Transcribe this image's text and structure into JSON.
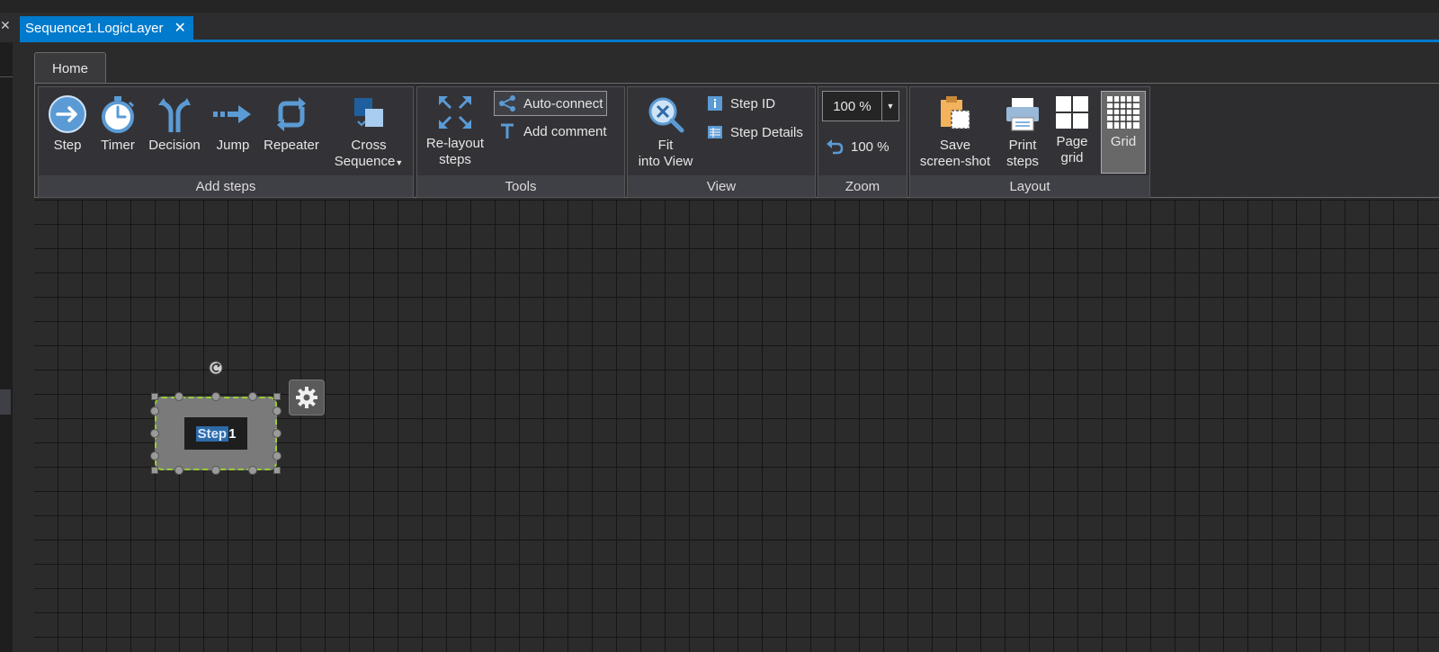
{
  "document_tab": {
    "title": "Sequence1.LogicLayer",
    "close_glyph": "✕"
  },
  "left_close_glyph": "✕",
  "ribbon": {
    "tab_home": "Home",
    "groups": {
      "add_steps": {
        "label": "Add steps",
        "step": "Step",
        "timer": "Timer",
        "decision": "Decision",
        "jump": "Jump",
        "repeater": "Repeater",
        "cross_sequence_line1": "Cross",
        "cross_sequence_line2": "Sequence"
      },
      "tools": {
        "label": "Tools",
        "relayout_line1": "Re-layout",
        "relayout_line2": "steps",
        "auto_connect": "Auto-connect",
        "add_comment": "Add comment"
      },
      "view": {
        "label": "View",
        "fit_line1": "Fit",
        "fit_line2": "into View",
        "step_id": "Step ID",
        "step_details": "Step Details"
      },
      "zoom": {
        "label": "Zoom",
        "combo_value": "100 %",
        "reset_value": "100 %"
      },
      "layout": {
        "label": "Layout",
        "save_line1": "Save",
        "save_line2": "screen-shot",
        "print_line1": "Print",
        "print_line2": "steps",
        "page_line1": "Page",
        "page_line2": "grid",
        "grid": "Grid"
      }
    }
  },
  "canvas": {
    "step_node": {
      "label_highlight": "Step",
      "label_number": " 1"
    }
  },
  "colors": {
    "accent": "#007acc",
    "selection_border": "#9acd32",
    "icon_blue": "#5b9bd5"
  }
}
